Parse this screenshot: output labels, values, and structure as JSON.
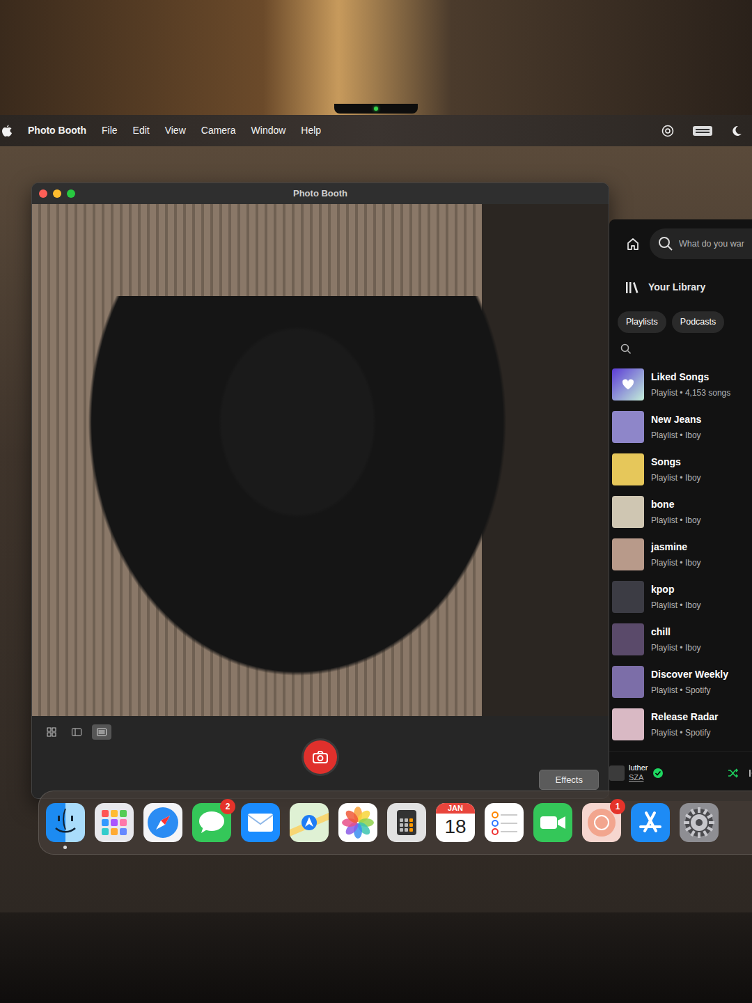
{
  "camera": {
    "indicator_on": true
  },
  "menu_bar": {
    "menus": [
      "Photo Booth",
      "File",
      "Edit",
      "View",
      "Camera",
      "Window",
      "Help"
    ]
  },
  "photo_booth": {
    "title": "Photo Booth",
    "view_modes": [
      {
        "kind": "grid",
        "selected": false
      },
      {
        "kind": "split",
        "selected": false
      },
      {
        "kind": "single",
        "selected": true
      }
    ],
    "effects_button": "Effects"
  },
  "spotify": {
    "search_placeholder": "What do you war",
    "library_title": "Your Library",
    "filters": [
      {
        "label": "Playlists",
        "selected": false
      },
      {
        "label": "Podcasts",
        "selected": false
      }
    ],
    "playlists": [
      {
        "title": "Liked Songs",
        "subtitle": "Playlist • 4,153 songs",
        "color": "#5b3bd6"
      },
      {
        "title": "New Jeans",
        "subtitle": "Playlist • Iboy",
        "color": "#8e86c9"
      },
      {
        "title": "Songs",
        "subtitle": "Playlist • Iboy",
        "color": "#e6c75a"
      },
      {
        "title": "bone",
        "subtitle": "Playlist • Iboy",
        "color": "#cfc6b2"
      },
      {
        "title": "jasmine",
        "subtitle": "Playlist • Iboy",
        "color": "#b89a8a"
      },
      {
        "title": "kpop",
        "subtitle": "Playlist • Iboy",
        "color": "#3c3c44"
      },
      {
        "title": "chill",
        "subtitle": "Playlist • Iboy",
        "color": "#5a4a6a"
      },
      {
        "title": "Discover Weekly",
        "subtitle": "Playlist • Spotify",
        "color": "#7c6ea8"
      },
      {
        "title": "Release Radar",
        "subtitle": "Playlist • Spotify",
        "color": "#d9b9c4"
      }
    ],
    "now_playing": {
      "title": "luther",
      "artist": "SZA",
      "saved": true,
      "shuffle": true
    }
  },
  "dock": [
    {
      "kind": "finder",
      "running": true
    },
    {
      "kind": "launchpad",
      "running": false
    },
    {
      "kind": "safari",
      "running": false
    },
    {
      "kind": "messages",
      "running": false,
      "badge": "2"
    },
    {
      "kind": "mail",
      "running": false
    },
    {
      "kind": "maps",
      "running": false
    },
    {
      "kind": "photos",
      "running": false
    },
    {
      "kind": "calculator",
      "running": false
    },
    {
      "kind": "calendar",
      "running": false,
      "month": "JAN",
      "day": "18"
    },
    {
      "kind": "reminders",
      "running": false
    },
    {
      "kind": "facetime",
      "running": false
    },
    {
      "kind": "app",
      "running": false,
      "badge": "1"
    },
    {
      "kind": "appstore",
      "running": false
    },
    {
      "kind": "settings",
      "running": false
    }
  ]
}
